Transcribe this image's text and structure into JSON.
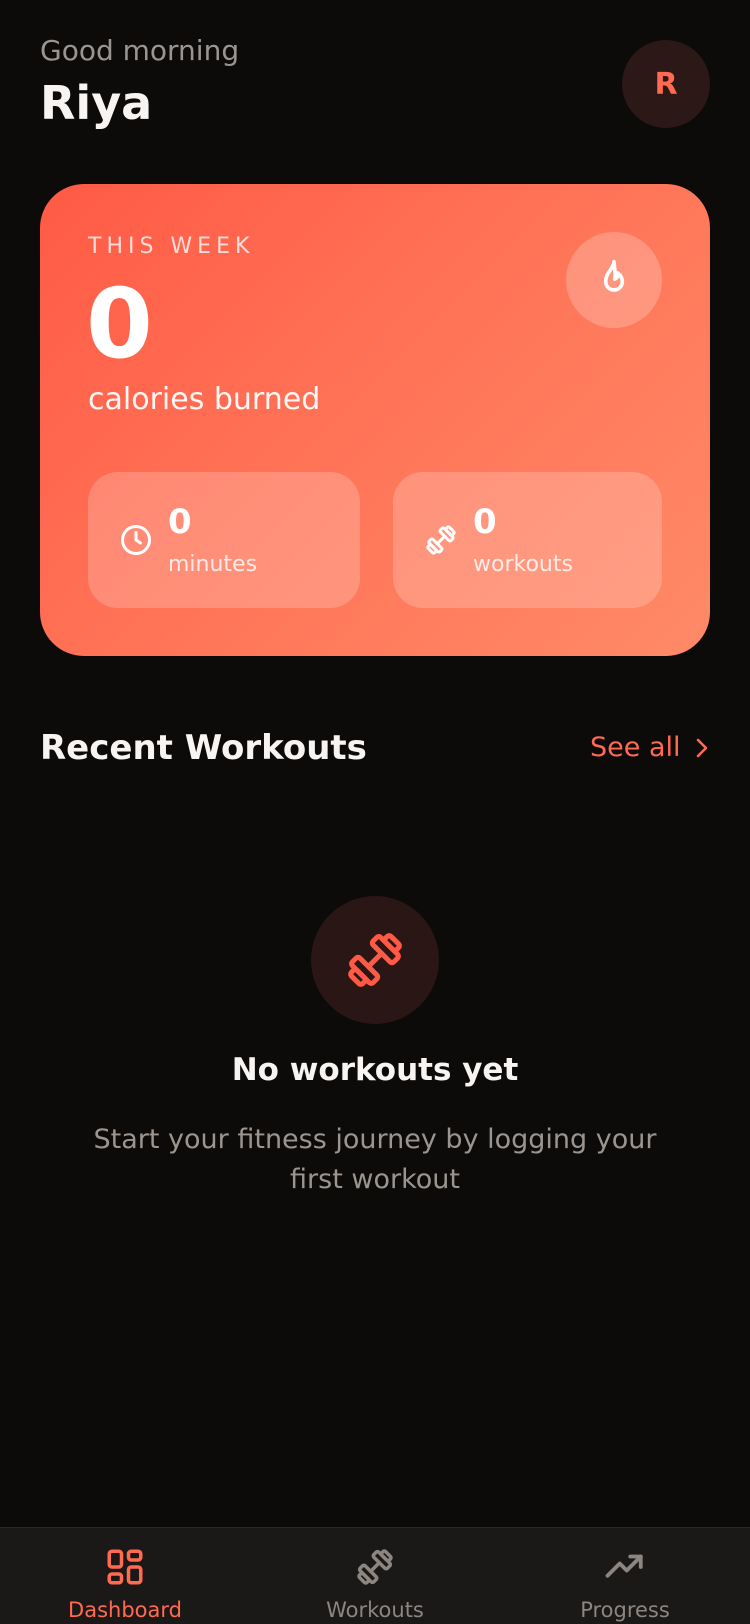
{
  "header": {
    "greeting": "Good morning",
    "username": "Riya",
    "avatar_initial": "R"
  },
  "stats": {
    "period_label": "THIS WEEK",
    "calories_value": "0",
    "calories_label": "calories burned",
    "minutes_value": "0",
    "minutes_label": "minutes",
    "workouts_value": "0",
    "workouts_label": "workouts",
    "icons": {
      "badge": "flame-icon",
      "minutes": "clock-icon",
      "workouts": "dumbbell-icon"
    }
  },
  "recent": {
    "title": "Recent Workouts",
    "see_all": "See all",
    "empty_title": "No workouts yet",
    "empty_subtitle": "Start your fitness journey by logging your first workout"
  },
  "nav": {
    "items": [
      {
        "label": "Dashboard",
        "icon": "grid-icon",
        "active": true
      },
      {
        "label": "Workouts",
        "icon": "dumbbell-icon",
        "active": false
      },
      {
        "label": "Progress",
        "icon": "trend-up-icon",
        "active": false
      }
    ]
  },
  "colors": {
    "accent": "#ff6a50",
    "background": "#0c0b0a",
    "card_gradient_start": "#ff5a45",
    "card_gradient_end": "#ff8a68",
    "nav_background": "#1b1918"
  }
}
